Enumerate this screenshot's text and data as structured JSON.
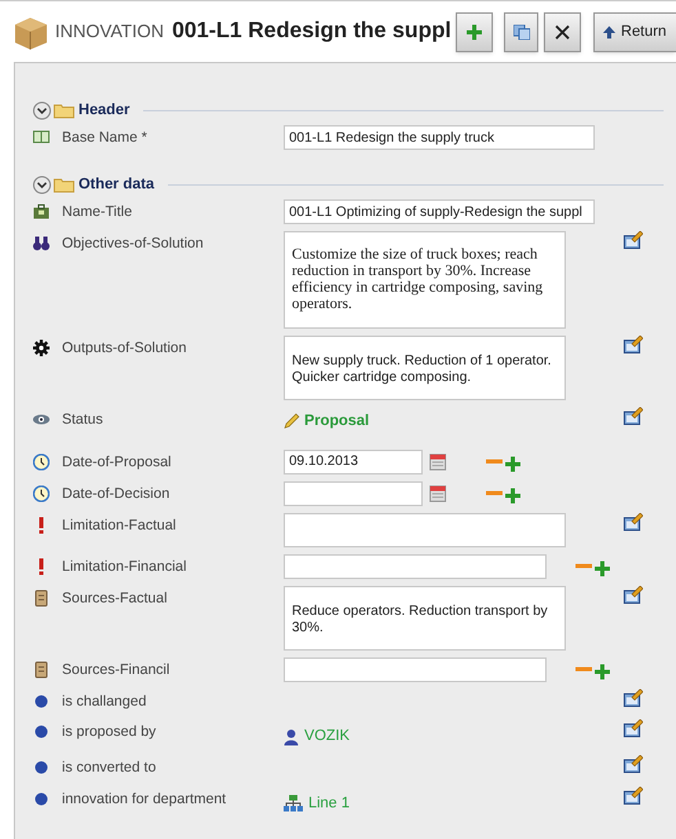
{
  "title": {
    "category": "INNOVATION",
    "name": "001-L1 Redesign the suppl"
  },
  "toolbar": {
    "return_label": "Return"
  },
  "sections": [
    {
      "title": "Header",
      "expanded": true,
      "rows": [
        {
          "kind": "text",
          "label": "Base Name *",
          "value": "001-L1 Redesign the supply truck",
          "edit": false,
          "add_remove": false
        }
      ]
    },
    {
      "title": "Other data",
      "expanded": true,
      "rows": [
        {
          "kind": "text",
          "label": "Name-Title",
          "value": "001-L1 Optimizing of supply-Redesign the suppl",
          "edit": false,
          "add_remove": false
        },
        {
          "kind": "memo",
          "label": "Objectives-of-Solution",
          "value": "Customize the size of truck boxes; reach reduction in transport by 30%. Increase efficiency in cartridge composing, saving operators.",
          "edit": true,
          "add_remove": false
        },
        {
          "kind": "memo",
          "label": "Outputs-of-Solution",
          "value": "New supply truck. Reduction of 1 operator. Quicker cartridge composing.",
          "edit": true,
          "add_remove": false
        },
        {
          "kind": "status",
          "label": "Status",
          "value": "Proposal",
          "edit": true,
          "add_remove": false
        },
        {
          "kind": "date",
          "label": "Date-of-Proposal",
          "value": "09.10.2013",
          "edit": false,
          "add_remove": true
        },
        {
          "kind": "date",
          "label": "Date-of-Decision",
          "edit": false,
          "add_remove": true
        },
        {
          "kind": "memo",
          "label": "Limitation-Factual",
          "edit": true,
          "add_remove": false
        },
        {
          "kind": "short",
          "label": "Limitation-Financial",
          "edit": false,
          "add_remove": true
        },
        {
          "kind": "memo",
          "label": "Sources-Factual",
          "value": "Reduce operators. Reduction transport by 30%.",
          "edit": true,
          "add_remove": false
        },
        {
          "kind": "short",
          "label": "Sources-Financil",
          "edit": false,
          "add_remove": true
        },
        {
          "kind": "relation",
          "label": "is challanged",
          "edit": true,
          "add_remove": false
        },
        {
          "kind": "relation",
          "label": "is proposed by",
          "value": "VOZIK",
          "edit": true,
          "add_remove": false
        },
        {
          "kind": "relation",
          "label": "is converted to",
          "edit": true,
          "add_remove": false
        },
        {
          "kind": "relation",
          "label": "innovation for department",
          "value": "Line 1",
          "edit": true,
          "add_remove": false
        }
      ]
    }
  ]
}
